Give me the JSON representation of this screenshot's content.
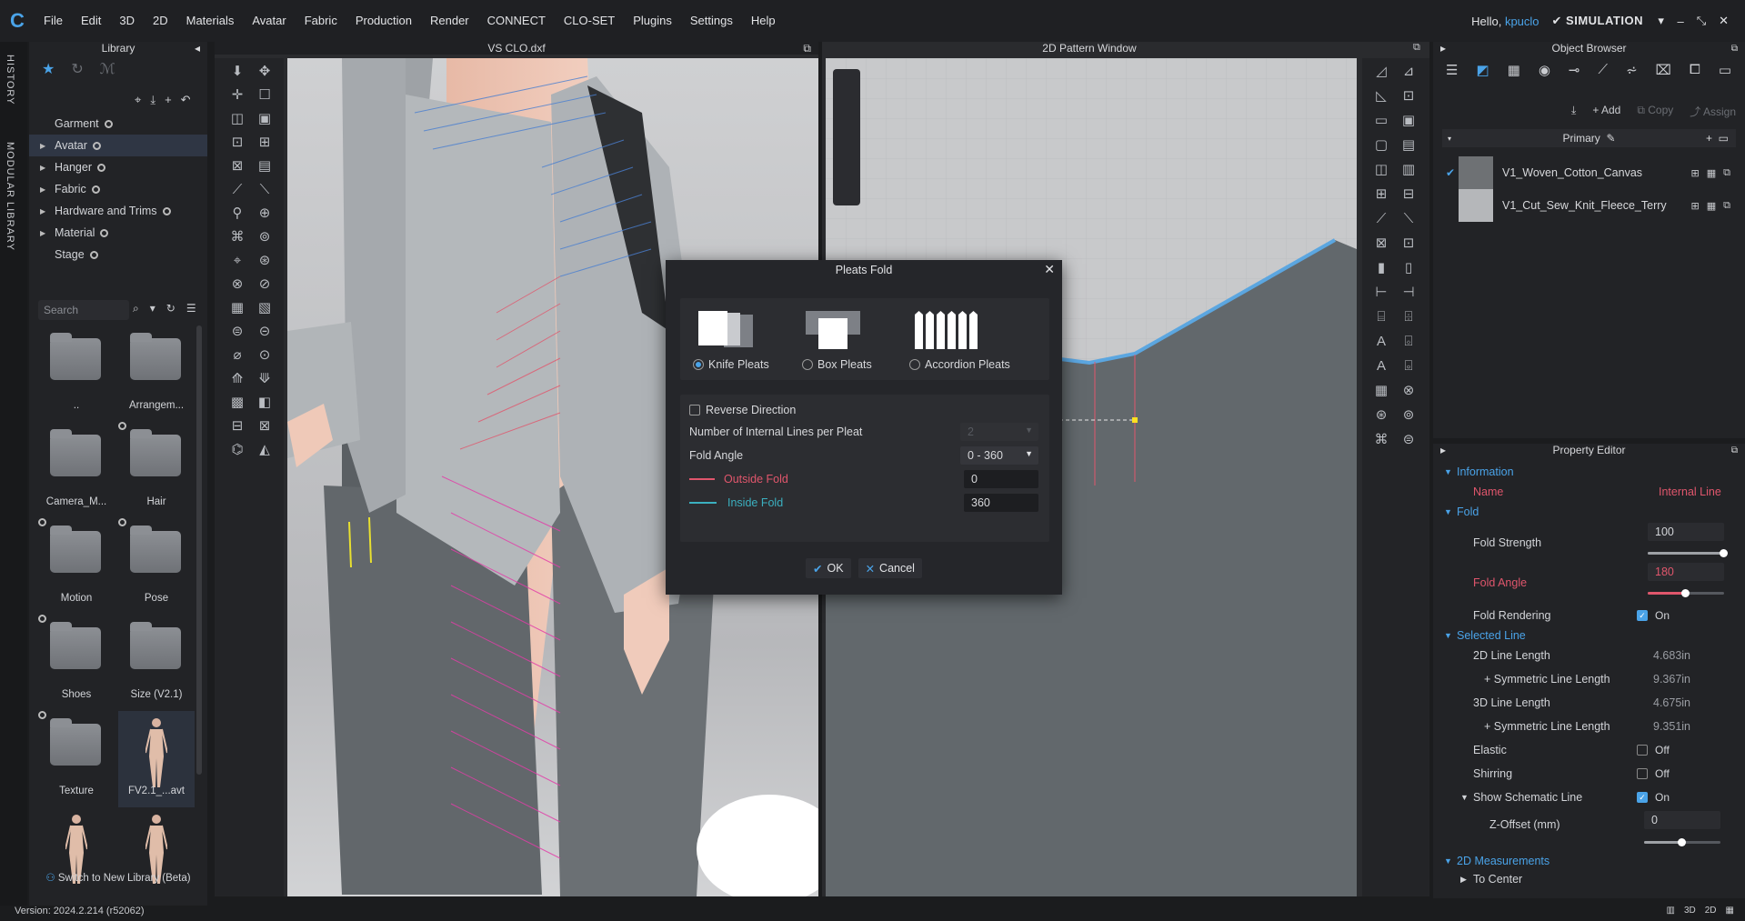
{
  "menu": {
    "items": [
      "File",
      "Edit",
      "3D",
      "2D",
      "Materials",
      "Avatar",
      "Fabric",
      "Production",
      "Render",
      "CONNECT",
      "CLO-SET",
      "Plugins",
      "Settings",
      "Help"
    ],
    "greeting": "Hello, ",
    "username": "kpuclo",
    "mode": "SIMULATION"
  },
  "vtabs": {
    "history": "HISTORY",
    "modular": "MODULAR LIBRARY"
  },
  "library": {
    "title": "Library",
    "tree": [
      {
        "label": "Garment",
        "arrow": false
      },
      {
        "label": "Avatar",
        "arrow": true,
        "selected": true
      },
      {
        "label": "Hanger",
        "arrow": true
      },
      {
        "label": "Fabric",
        "arrow": true
      },
      {
        "label": "Hardware and Trims",
        "arrow": true
      },
      {
        "label": "Material",
        "arrow": true
      },
      {
        "label": "Stage",
        "arrow": false
      }
    ],
    "search_placeholder": "Search",
    "items": [
      "..",
      "Arrangem...",
      "Camera_M...",
      "Hair",
      "Motion",
      "Pose",
      "Shoes",
      "Size (V2.1)",
      "Texture",
      "FV2.1_...avt",
      "",
      ""
    ],
    "footer": "Switch to New Library (Beta)"
  },
  "view3d": {
    "title": "VS CLO.dxf"
  },
  "view2d": {
    "title": "2D Pattern Window"
  },
  "object_browser": {
    "title": "Object Browser",
    "add": "Add",
    "copy": "Copy",
    "assign": "Assign",
    "group": "Primary",
    "fabrics": [
      {
        "name": "V1_Woven_Cotton_Canvas",
        "color": "#6e7174",
        "checked": true
      },
      {
        "name": "V1_Cut_Sew_Knit_Fleece_Terry",
        "color": "#b5b7ba",
        "checked": false
      }
    ]
  },
  "property_editor": {
    "title": "Property Editor",
    "information": "Information",
    "name_label": "Name",
    "name_value": "Internal Line",
    "fold": "Fold",
    "fold_strength_label": "Fold Strength",
    "fold_strength": "100",
    "fold_strength_level": 1.0,
    "fold_angle_label": "Fold Angle",
    "fold_angle": "180",
    "fold_angle_level": 0.5,
    "fold_rendering_label": "Fold Rendering",
    "on": "On",
    "off": "Off",
    "selected_line": "Selected Line",
    "line2d_label": "2D Line Length",
    "line2d": "4.683in",
    "sym1_label": "+ Symmetric Line Length",
    "sym1": "9.367in",
    "line3d_label": "3D Line Length",
    "line3d": "4.675in",
    "sym2_label": "+ Symmetric Line Length",
    "sym2": "9.351in",
    "elastic_label": "Elastic",
    "shirring_label": "Shirring",
    "schematic_label": "Show Schematic Line",
    "zoffset_label": "Z-Offset (mm)",
    "zoffset": "0",
    "zoffset_level": 0.5,
    "measurements": "2D Measurements",
    "to_center": "To Center"
  },
  "status": {
    "version": "Version: 2024.2.214 (r52062)"
  },
  "dialog": {
    "title": "Pleats Fold",
    "types": [
      "Knife Pleats",
      "Box Pleats",
      "Accordion Pleats"
    ],
    "selected_type": "Knife Pleats",
    "reverse": "Reverse Direction",
    "lines_label": "Number of Internal Lines per Pleat",
    "lines_value": "2",
    "angle_label": "Fold Angle",
    "angle_value": "0 - 360",
    "outside_label": "Outside Fold",
    "outside_value": "0",
    "inside_label": "Inside Fold",
    "inside_value": "360",
    "ok": "OK",
    "cancel": "Cancel"
  },
  "colors": {
    "accent": "#4aa3e8",
    "outside_fold": "#e0566c",
    "inside_fold": "#3bb0c0"
  }
}
